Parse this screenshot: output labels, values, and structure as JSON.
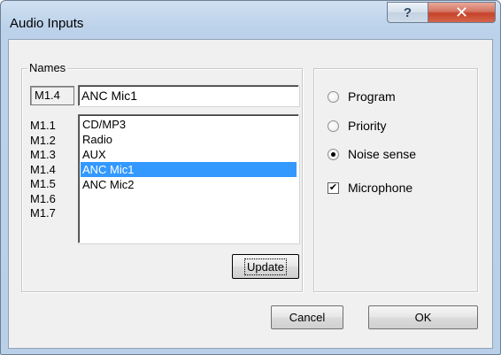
{
  "window": {
    "title": "Audio Inputs",
    "help_glyph": "?",
    "close_glyph": "✕"
  },
  "names": {
    "legend": "Names",
    "current_label": "M1.4",
    "current_value": "ANC Mic1",
    "slot_labels": [
      "M1.1",
      "M1.2",
      "M1.3",
      "M1.4",
      "M1.5",
      "M1.6",
      "M1.7"
    ],
    "list_items": [
      "CD/MP3",
      "Radio",
      "AUX",
      "ANC Mic1",
      "ANC Mic2"
    ],
    "selected_index": 3,
    "update_label": "Update"
  },
  "options": {
    "radios": [
      {
        "label": "Program",
        "checked": false
      },
      {
        "label": "Priority",
        "checked": false
      },
      {
        "label": "Noise sense",
        "checked": true
      }
    ],
    "microphone": {
      "label": "Microphone",
      "checked": true
    }
  },
  "footer": {
    "cancel_label": "Cancel",
    "ok_label": "OK"
  },
  "colors": {
    "selection": "#3399ff",
    "close_button": "#c7432a"
  }
}
